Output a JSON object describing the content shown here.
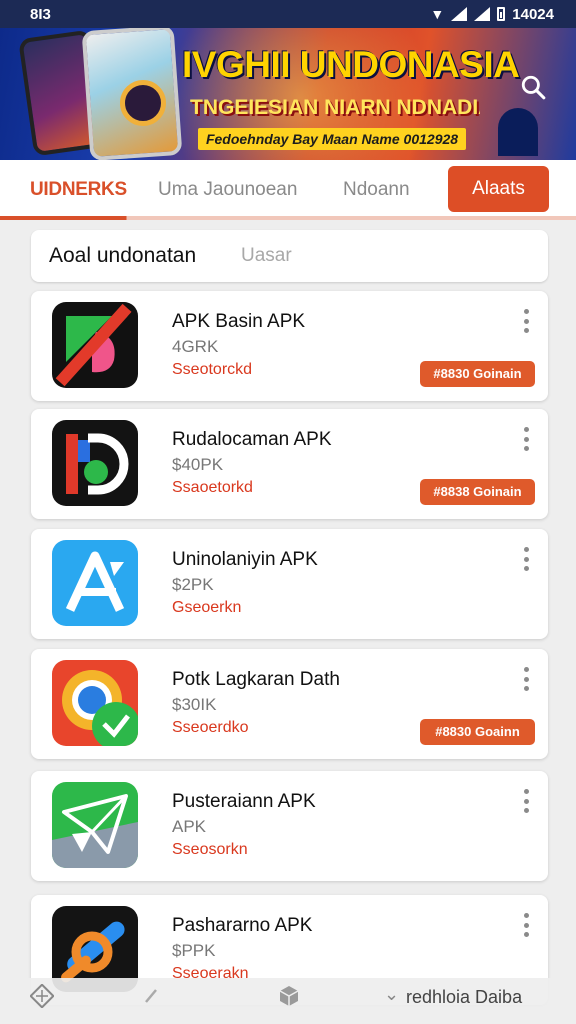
{
  "status_bar": {
    "time_left": "8I3",
    "time_right": "14024"
  },
  "banner": {
    "title": "IVGHII UNDONASIA",
    "subtitle": "TNGEIESIAN NIARN NDNADIA",
    "date_line": "Fedoehnday Bay Maan Name 0012928"
  },
  "tabs": [
    {
      "label": "UIDNERKS"
    },
    {
      "label": "Uma Jaounoean"
    },
    {
      "label": "Ndoann"
    },
    {
      "label": "Alaats"
    }
  ],
  "search": {
    "label": "Aoal undonatan",
    "placeholder": "Uasar"
  },
  "apps": [
    {
      "name": "APK Basin APK",
      "size": "4GRK",
      "status": "Sseotorckd",
      "button": "#8830 Goinain",
      "icon": "brush-app-icon"
    },
    {
      "name": "Rudalocaman APK",
      "size": "$40PK",
      "status": "Ssaoetorkd",
      "button": "#8838 Goinain",
      "icon": "letter-d-app-icon"
    },
    {
      "name": "Uninolaniyin APK",
      "size": "$2PK",
      "status": "Gseoerkn",
      "button": "",
      "icon": "letter-a-app-icon"
    },
    {
      "name": "Potk Lagkaran Dath",
      "size": "$30IK",
      "status": "Sseoerdko",
      "button": "#8830 Goainn",
      "icon": "chrome-android-app-icon"
    },
    {
      "name": "Pusteraiann APK",
      "size": "APK",
      "status": "Sseosorkn",
      "button": "",
      "icon": "paper-plane-app-icon"
    },
    {
      "name": "Pashararno APK",
      "size": "$PPK",
      "status": "Sseoerakn",
      "button": "",
      "icon": "wrench-app-icon"
    }
  ],
  "bottom_nav": {
    "text": "redhloia Daiba"
  },
  "colors": {
    "accent": "#dd4e26",
    "status_red": "#d9381e",
    "banner_blue": "#1b3fb0"
  }
}
